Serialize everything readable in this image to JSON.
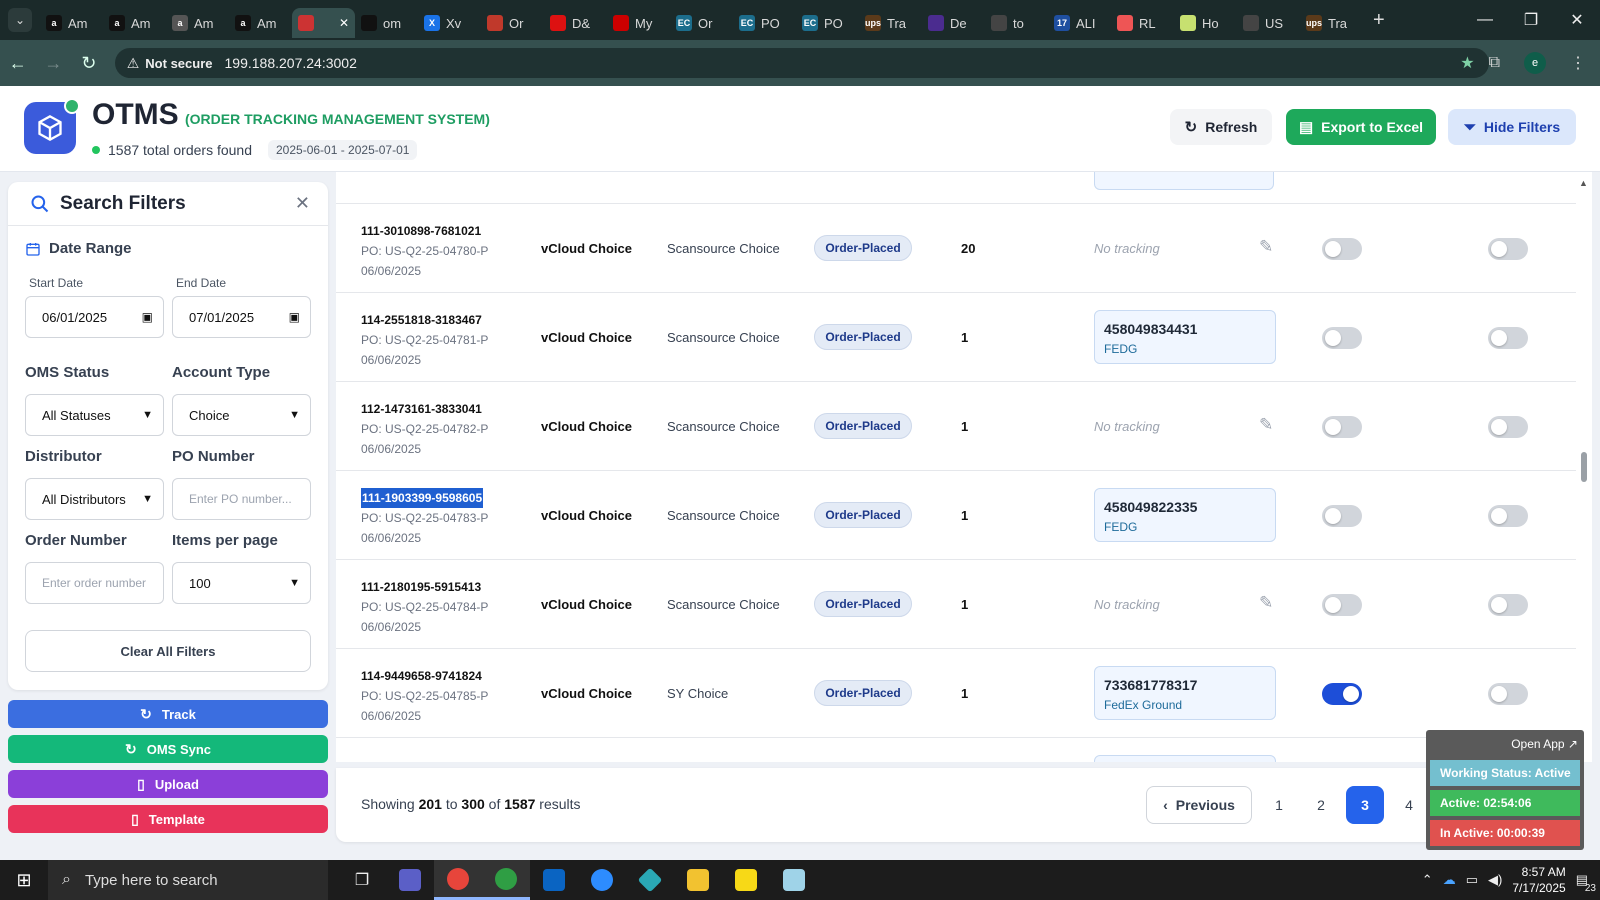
{
  "browser": {
    "tabs": [
      {
        "label": "Am",
        "fav": "a",
        "color": "#111"
      },
      {
        "label": "Am",
        "fav": "a",
        "color": "#111"
      },
      {
        "label": "Am",
        "fav": "a",
        "color": "#555"
      },
      {
        "label": "Am",
        "fav": "a",
        "color": "#111"
      },
      {
        "label": "",
        "fav": "",
        "color": "#c33",
        "active": true
      },
      {
        "label": "om",
        "fav": "",
        "color": "#111"
      },
      {
        "label": "Xv",
        "fav": "X",
        "color": "#1a73e8"
      },
      {
        "label": "Or",
        "fav": "",
        "color": "#c0392b"
      },
      {
        "label": "D&",
        "fav": "",
        "color": "#d11"
      },
      {
        "label": "My",
        "fav": "",
        "color": "#c00"
      },
      {
        "label": "Or",
        "fav": "EC",
        "color": "#1c6d8c"
      },
      {
        "label": "PO",
        "fav": "EC",
        "color": "#1c6d8c"
      },
      {
        "label": "PO",
        "fav": "EC",
        "color": "#1c6d8c"
      },
      {
        "label": "Tra",
        "fav": "ups",
        "color": "#5b3a1a"
      },
      {
        "label": "De",
        "fav": "",
        "color": "#4b2c8f"
      },
      {
        "label": "to",
        "fav": "",
        "color": "#444"
      },
      {
        "label": "ALI",
        "fav": "17",
        "color": "#1f4fa0"
      },
      {
        "label": "RL",
        "fav": "",
        "color": "#e55"
      },
      {
        "label": "Ho",
        "fav": "",
        "color": "#c7e070"
      },
      {
        "label": "US",
        "fav": "",
        "color": "#444"
      },
      {
        "label": "Tra",
        "fav": "ups",
        "color": "#5b3a1a"
      }
    ],
    "security": "Not secure",
    "url": "199.188.207.24:3002",
    "profile_initial": "e"
  },
  "header": {
    "title": "OTMS",
    "subtitle": "(ORDER TRACKING MANAGEMENT SYSTEM)",
    "total_orders": "1587 total orders found",
    "date_range": "2025-06-01 - 2025-07-01",
    "refresh_label": "Refresh",
    "export_label": "Export to Excel",
    "hide_filters_label": "Hide Filters"
  },
  "filters": {
    "title": "Search Filters",
    "date_range_label": "Date Range",
    "start_label": "Start Date",
    "start_value": "06/01/2025",
    "end_label": "End Date",
    "end_value": "07/01/2025",
    "oms_status_label": "OMS Status",
    "oms_status_value": "All Statuses",
    "account_type_label": "Account Type",
    "account_type_value": "Choice",
    "distributor_label": "Distributor",
    "distributor_value": "All Distributors",
    "po_label": "PO Number",
    "po_placeholder": "Enter PO number...",
    "order_label": "Order Number",
    "order_placeholder": "Enter order number",
    "ipp_label": "Items per page",
    "ipp_value": "100",
    "clear_label": "Clear All Filters"
  },
  "actions": {
    "track": "Track",
    "oms_sync": "OMS Sync",
    "upload": "Upload",
    "template": "Template"
  },
  "rows": [
    {
      "order": "111-3010898-7681021",
      "po": "PO: US-Q2-25-04780-P",
      "date": "06/06/2025",
      "account": "vCloud Choice",
      "distributor": "Scansource Choice",
      "status": "Order-Placed",
      "qty": "20",
      "tracking": null,
      "no_tracking": "No tracking",
      "toggle1": false,
      "toggle2": false
    },
    {
      "order": "114-2551818-3183467",
      "po": "PO: US-Q2-25-04781-P",
      "date": "06/06/2025",
      "account": "vCloud Choice",
      "distributor": "Scansource Choice",
      "status": "Order-Placed",
      "qty": "1",
      "tracking": "458049834431",
      "carrier": "FEDG",
      "toggle1": false,
      "toggle2": false
    },
    {
      "order": "112-1473161-3833041",
      "po": "PO: US-Q2-25-04782-P",
      "date": "06/06/2025",
      "account": "vCloud Choice",
      "distributor": "Scansource Choice",
      "status": "Order-Placed",
      "qty": "1",
      "tracking": null,
      "no_tracking": "No tracking",
      "toggle1": false,
      "toggle2": false
    },
    {
      "order": "111-1903399-9598605",
      "po": "PO: US-Q2-25-04783-P",
      "date": "06/06/2025",
      "account": "vCloud Choice",
      "distributor": "Scansource Choice",
      "status": "Order-Placed",
      "qty": "1",
      "tracking": "458049822335",
      "carrier": "FEDG",
      "toggle1": false,
      "toggle2": false,
      "selected": true
    },
    {
      "order": "111-2180195-5915413",
      "po": "PO: US-Q2-25-04784-P",
      "date": "06/06/2025",
      "account": "vCloud Choice",
      "distributor": "Scansource Choice",
      "status": "Order-Placed",
      "qty": "1",
      "tracking": null,
      "no_tracking": "No tracking",
      "toggle1": false,
      "toggle2": false
    },
    {
      "order": "114-9449658-9741824",
      "po": "PO: US-Q2-25-04785-P",
      "date": "06/06/2025",
      "account": "vCloud Choice",
      "distributor": "SY Choice",
      "status": "Order-Placed",
      "qty": "1",
      "tracking": "733681778317",
      "carrier": "FedEx Ground",
      "toggle1": true,
      "toggle2": false
    }
  ],
  "pagination": {
    "prefix": "Showing",
    "from": "201",
    "to_word": "to",
    "to": "300",
    "of_word": "of",
    "total": "1587",
    "suffix": "results",
    "previous": "Previous",
    "pages": [
      "1",
      "2",
      "3",
      "4"
    ],
    "current": "3"
  },
  "widget": {
    "open_app": "Open App ↗",
    "working_status": "Working Status: Active",
    "active": "Active: 02:54:06",
    "inactive": "In Active: 00:00:39"
  },
  "taskbar": {
    "search_placeholder": "Type here to search",
    "time": "8:57 AM",
    "date": "7/17/2025",
    "notif_count": "23"
  },
  "colors": {
    "accent": "#2563eb",
    "green": "#1e9d62",
    "track": "#3b5bdb",
    "sync": "#14b87a",
    "upload": "#8b3fd9",
    "template": "#e8335a"
  }
}
